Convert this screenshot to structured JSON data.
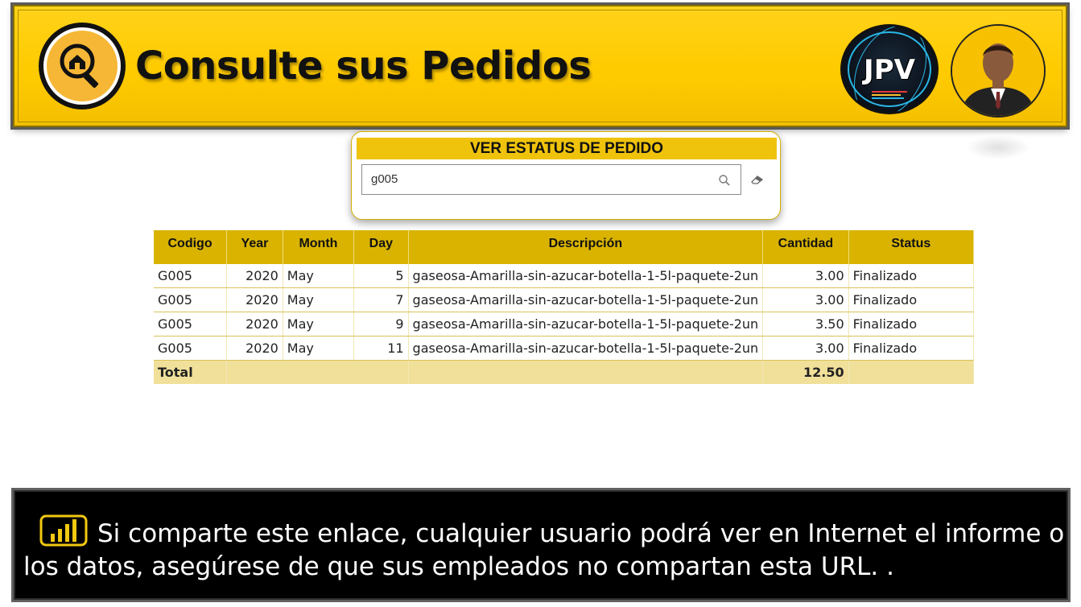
{
  "header": {
    "title": "Consulte sus Pedidos",
    "brand_text": "JPV"
  },
  "search": {
    "title": "VER ESTATUS DE PEDIDO",
    "value": "g005"
  },
  "table": {
    "columns": [
      "Codigo",
      "Year",
      "Month",
      "Day",
      "Descripción",
      "Cantidad",
      "Status"
    ],
    "rows": [
      {
        "codigo": "G005",
        "year": "2020",
        "month": "May",
        "day": "5",
        "descripcion": "gaseosa-Amarilla-sin-azucar-botella-1-5l-paquete-2un",
        "cantidad": "3.00",
        "status": "Finalizado"
      },
      {
        "codigo": "G005",
        "year": "2020",
        "month": "May",
        "day": "7",
        "descripcion": "gaseosa-Amarilla-sin-azucar-botella-1-5l-paquete-2un",
        "cantidad": "3.00",
        "status": "Finalizado"
      },
      {
        "codigo": "G005",
        "year": "2020",
        "month": "May",
        "day": "9",
        "descripcion": "gaseosa-Amarilla-sin-azucar-botella-1-5l-paquete-2un",
        "cantidad": "3.50",
        "status": "Finalizado"
      },
      {
        "codigo": "G005",
        "year": "2020",
        "month": "May",
        "day": "11",
        "descripcion": "gaseosa-Amarilla-sin-azucar-botella-1-5l-paquete-2un",
        "cantidad": "3.00",
        "status": "Finalizado"
      }
    ],
    "total_label": "Total",
    "total_cantidad": "12.50"
  },
  "footer": {
    "message": "Si comparte este enlace, cualquier usuario podrá ver en Internet el informe o los datos, asegúrese de que sus empleados no compartan esta URL. ."
  },
  "colors": {
    "accent": "#ffcb00",
    "table_header": "#d9b300",
    "total_row": "#f0e09a",
    "footer_bg": "#000000"
  }
}
